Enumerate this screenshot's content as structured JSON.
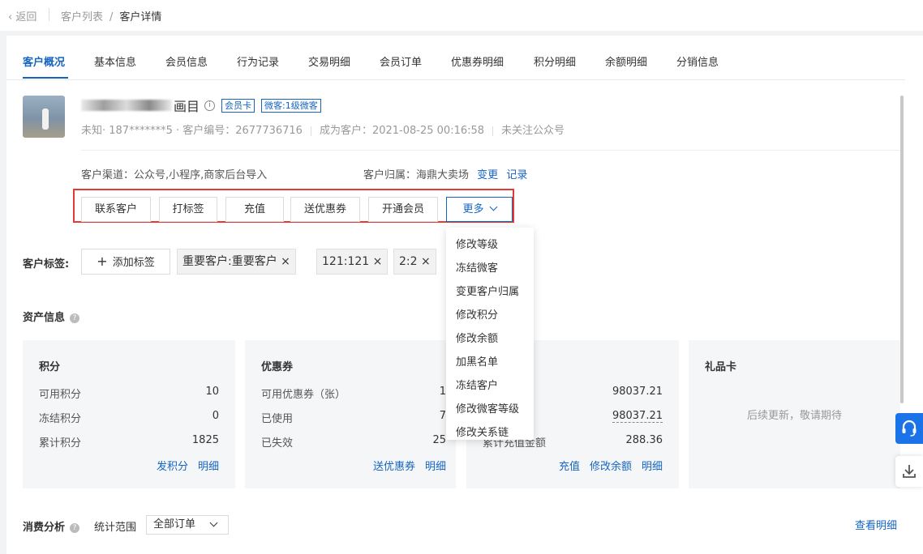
{
  "topbar": {
    "back_label": "返回",
    "breadcrumb": [
      "客户列表",
      "客户详情"
    ]
  },
  "tabs": [
    {
      "label": "客户概况",
      "active": true
    },
    {
      "label": "基本信息"
    },
    {
      "label": "会员信息"
    },
    {
      "label": "行为记录"
    },
    {
      "label": "交易明细"
    },
    {
      "label": "会员订单"
    },
    {
      "label": "优惠券明细"
    },
    {
      "label": "积分明细"
    },
    {
      "label": "余额明细"
    },
    {
      "label": "分销信息"
    }
  ],
  "customer": {
    "name_tail": "画目",
    "badges": [
      "会员卡",
      "微客:1级微客"
    ],
    "sub_part1": "未知· 187*******5 · 客户编号：2677736716",
    "sub_part2": "成为客户：2021-08-25 00:16:58",
    "sub_part3": "未关注公众号",
    "channel": "客户渠道：公众号,小程序,商家后台导入",
    "owner_label": "客户归属：海鼎大卖场",
    "owner_change": "变更",
    "owner_record": "记录"
  },
  "actions": [
    "联系客户",
    "打标签",
    "充值",
    "送优惠券",
    "开通会员"
  ],
  "more_label": "更多",
  "more_menu": [
    "修改等级",
    "冻结微客",
    "变更客户归属",
    "修改积分",
    "修改余额",
    "加黑名单",
    "冻结客户",
    "修改微客等级",
    "修改关系链"
  ],
  "tags": {
    "label": "客户标签:",
    "add_label": "添加标签",
    "items": [
      "重要客户:重要客户",
      "121:121",
      "2:2"
    ]
  },
  "assets": {
    "title": "资产信息",
    "points": {
      "title": "积分",
      "rows": [
        {
          "label": "可用积分",
          "value": "10"
        },
        {
          "label": "冻结积分",
          "value": "0"
        },
        {
          "label": "累计积分",
          "value": "1825"
        }
      ],
      "links": [
        "发积分",
        "明细"
      ]
    },
    "coupons": {
      "title": "优惠券",
      "rows": [
        {
          "label": "可用优惠券（张）",
          "value": "1"
        },
        {
          "label": "已使用",
          "value": "7"
        },
        {
          "label": "已失效",
          "value": "25"
        }
      ],
      "links": [
        "送优惠券",
        "明细"
      ]
    },
    "balance": {
      "rows": [
        {
          "label": "",
          "value": "98037.21"
        },
        {
          "label": "",
          "value": "98037.21"
        },
        {
          "label": "累计充值金额",
          "value": "288.36"
        }
      ],
      "links": [
        "充值",
        "修改余额",
        "明细"
      ]
    },
    "giftcard": {
      "title": "礼品卡",
      "empty": "后续更新，敬请期待"
    }
  },
  "consume": {
    "title": "消费分析",
    "range_label": "统计范围",
    "range_value": "全部订单",
    "view_detail": "查看明细"
  }
}
